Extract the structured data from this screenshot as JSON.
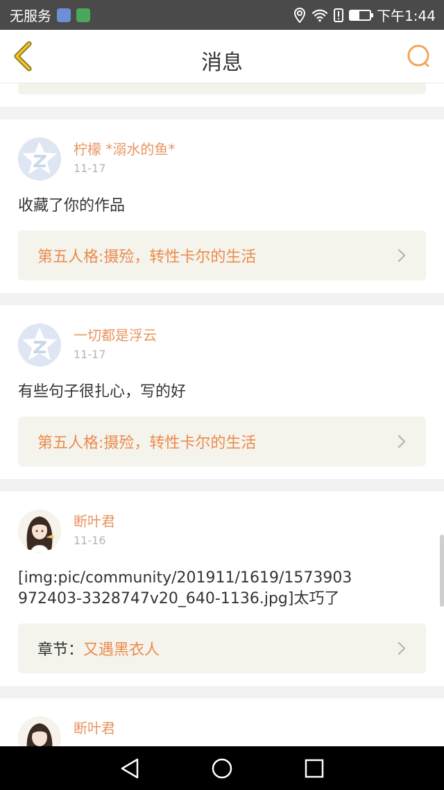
{
  "status_bar": {
    "carrier": "无服务",
    "time": "下午1:44",
    "battery_level": 0.45
  },
  "header": {
    "title": "消息"
  },
  "messages": [
    {
      "name": "柠檬 *溺水的鱼*",
      "date": "11-17",
      "comment": "收藏了你的作品",
      "work_prefix": "",
      "work_title": "第五人格:摄殓，转性卡尔的生活"
    },
    {
      "name": "一切都是浮云",
      "date": "11-17",
      "comment": "有些句子很扎心，写的好",
      "work_prefix": "",
      "work_title": "第五人格:摄殓，转性卡尔的生活"
    },
    {
      "name": "断叶君",
      "date": "11-16",
      "comment": "[img:pic/community/201911/1619/1573903972403-3328747v20_640-1136.jpg]太巧了",
      "work_prefix": "章节：",
      "work_title": "又遇黑衣人"
    },
    {
      "name": "断叶君"
    }
  ],
  "icons": {
    "back": "back-chevron-icon",
    "search": "search-icon",
    "chevron": "chevron-right-icon"
  },
  "colors": {
    "accent": "#ec8a4c",
    "name": "#e8945f",
    "back_icon": "#e8b21f"
  }
}
